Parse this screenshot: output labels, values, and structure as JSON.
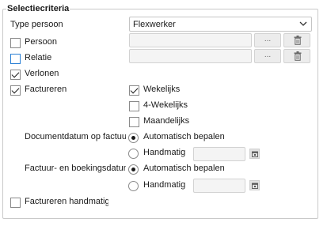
{
  "group": {
    "title": "Selectiecriteria"
  },
  "type_persoon": {
    "label": "Type persoon",
    "selected": "Flexwerker"
  },
  "persoon": {
    "label": "Persoon",
    "checked": false,
    "browse_label": "..."
  },
  "relatie": {
    "label": "Relatie",
    "checked": false,
    "browse_label": "..."
  },
  "verlonen": {
    "label": "Verlonen",
    "checked": true
  },
  "factureren": {
    "label": "Factureren",
    "checked": true
  },
  "periods": [
    {
      "label": "Wekelijks",
      "checked": true
    },
    {
      "label": "4-Wekelijks",
      "checked": false
    },
    {
      "label": "Maandelijks",
      "checked": false
    }
  ],
  "documentdatum": {
    "label": "Documentdatum op factuur",
    "auto_label": "Automatisch bepalen",
    "manual_label": "Handmatig",
    "selected": "Automatisch bepalen"
  },
  "boekingsdatum": {
    "label": "Factuur- en boekingsdatum",
    "auto_label": "Automatisch bepalen",
    "manual_label": "Handmatig",
    "selected": "Automatisch bepalen"
  },
  "factureren_handmatig": {
    "label": "Factureren handmatig",
    "checked": false
  },
  "icons": {
    "dropdown": "chevron-down-icon",
    "delete": "trash-icon",
    "date": "calendar-icon"
  }
}
